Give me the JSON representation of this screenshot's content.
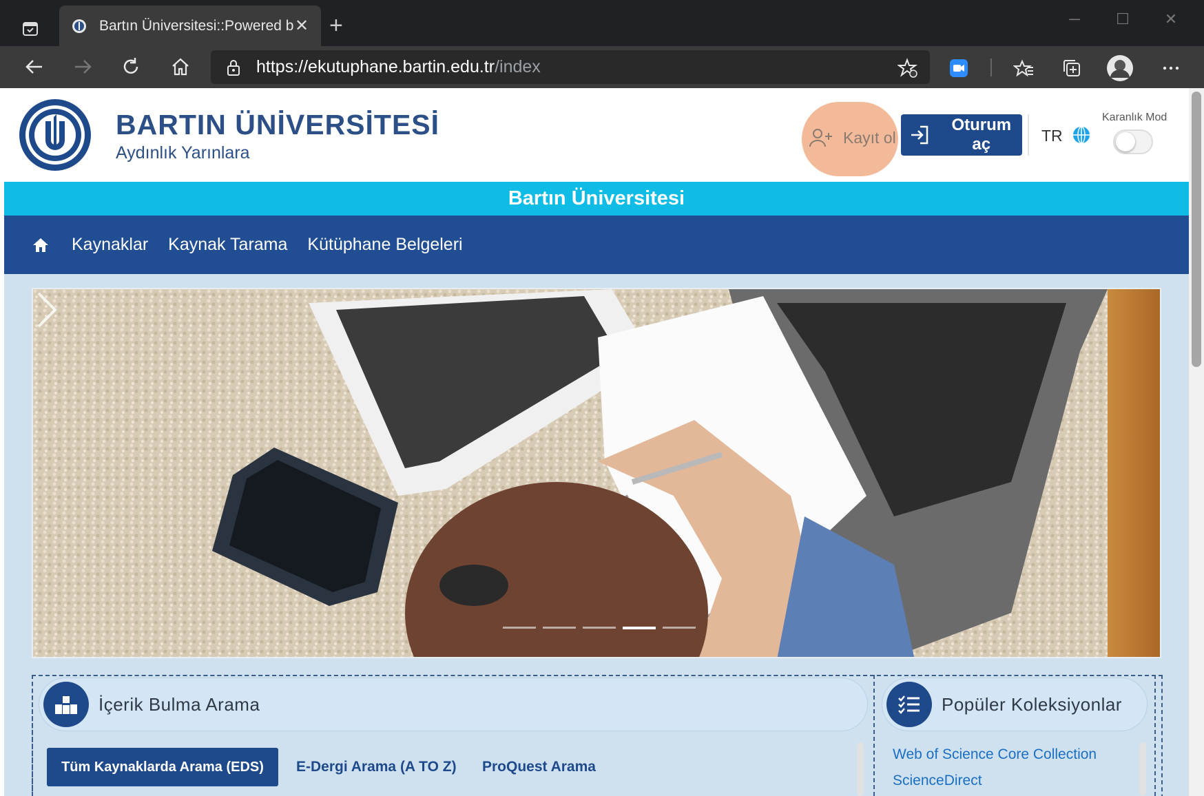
{
  "browser": {
    "tab_title": "Bartın Üniversitesi::Powered by D",
    "url_scheme": "https://",
    "url_host": "ekutuphane.bartin.edu.tr",
    "url_path": "/index"
  },
  "header": {
    "brand_name": "BARTIN ÜNİVERSİTESİ",
    "brand_tagline": "Aydınlık Yarınlara",
    "register_label": "Kayıt ol",
    "login_label": "Oturum aç",
    "language": "TR",
    "dark_mode_label": "Karanlık Mod",
    "dark_mode_on": false
  },
  "banner": {
    "title": "Bartın Üniversitesi"
  },
  "nav": {
    "items": [
      "Kaynaklar",
      "Kaynak Tarama",
      "Kütüphane Belgeleri"
    ]
  },
  "carousel": {
    "slide_count": 5,
    "active_index": 3
  },
  "search_panel": {
    "title": "İçerik Bulma Arama",
    "tabs": [
      "Tüm Kaynaklarda Arama (EDS)",
      "E-Dergi Arama (A TO Z)",
      "ProQuest Arama"
    ],
    "active_tab": 0
  },
  "collections_panel": {
    "title": "Popüler Koleksiyonlar",
    "items": [
      "Web of Science Core Collection",
      "ScienceDirect"
    ]
  },
  "colors": {
    "brand_blue": "#214d93",
    "cyan": "#0ebce6",
    "register_highlight": "#f2b28e"
  }
}
